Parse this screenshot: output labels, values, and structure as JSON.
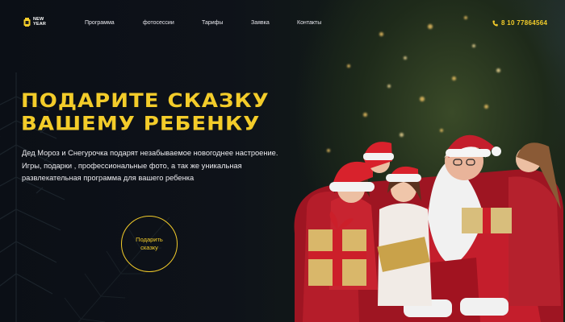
{
  "header": {
    "logo_line1": "NEW",
    "logo_line2": "YEAR",
    "nav": [
      "Программа",
      "фотосессии",
      "Тарифы",
      "Заявка",
      "Контакты"
    ],
    "phone": "8 10 77864564"
  },
  "hero": {
    "title_line1": "Подарите сказку",
    "title_line2": "вашему ребенку",
    "description": "Дед Мороз и Снегурочка подарят незабываемое новогоднее настроение. Игры, подарки , профессиональные фото, а так же уникальная развлекательная программа для вашего ребенка",
    "cta_label": "Подарить сказку"
  },
  "colors": {
    "accent": "#f3cc2a",
    "background": "#0b0f16",
    "text": "#ececf0"
  },
  "icons": {
    "logo": "lantern-logo-icon",
    "phone": "phone-icon"
  }
}
